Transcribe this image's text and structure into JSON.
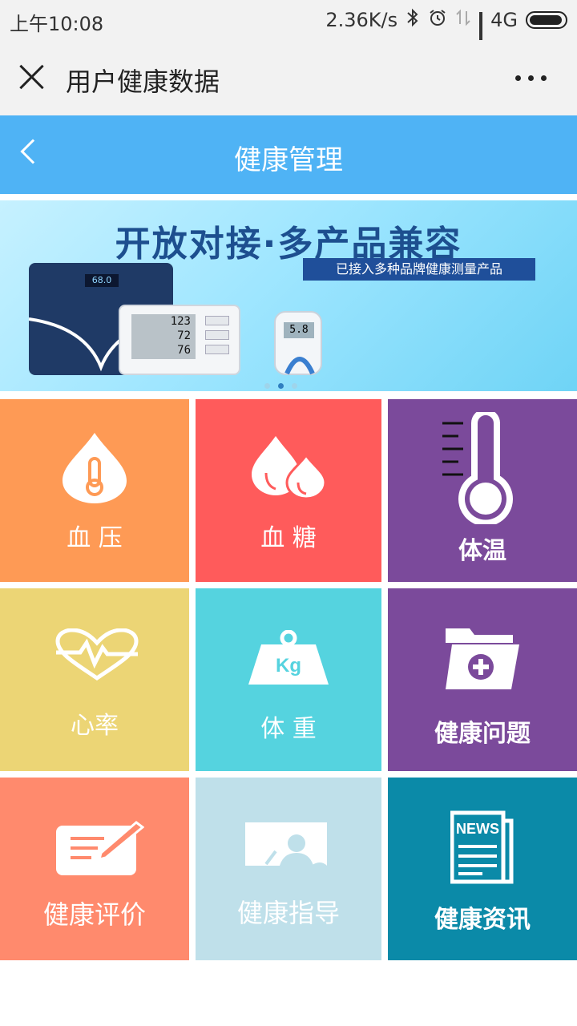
{
  "status_bar": {
    "time": "上午10:08",
    "network_speed": "2.36K/s",
    "network_type": "4G"
  },
  "title_bar": {
    "title": "用户健康数据"
  },
  "header": {
    "title": "健康管理"
  },
  "banner": {
    "headline": "开放对接·多产品兼容",
    "subtitle": "已接入多种品牌健康测量产品",
    "scale_reading": "68.0",
    "bp_reading_sys": "123",
    "bp_reading_dia": "72",
    "bp_reading_pulse": "76",
    "glucose_reading": "5.8",
    "slide_index": 1,
    "slide_count": 3
  },
  "tiles": [
    {
      "label": "血 压",
      "icon": "blood-drop-thermometer-icon",
      "color": "#fe9a55"
    },
    {
      "label": "血 糖",
      "icon": "double-drop-icon",
      "color": "#ff5b5b"
    },
    {
      "label": "体温",
      "icon": "thermometer-icon",
      "color": "#7b4a9b"
    },
    {
      "label": "心率",
      "icon": "heart-rate-icon",
      "color": "#ecd575"
    },
    {
      "label": "体 重",
      "icon": "weight-kg-icon",
      "color": "#55d3df"
    },
    {
      "label": "健康问题",
      "icon": "medical-folder-icon",
      "color": "#7b4a9b"
    },
    {
      "label": "健康评价",
      "icon": "evaluation-pen-icon",
      "color": "#ff8a6d"
    },
    {
      "label": "健康指导",
      "icon": "guidance-board-icon",
      "color": "#bfe0ea"
    },
    {
      "label": "健康资讯",
      "icon": "news-icon",
      "color": "#0b8aa8"
    }
  ]
}
